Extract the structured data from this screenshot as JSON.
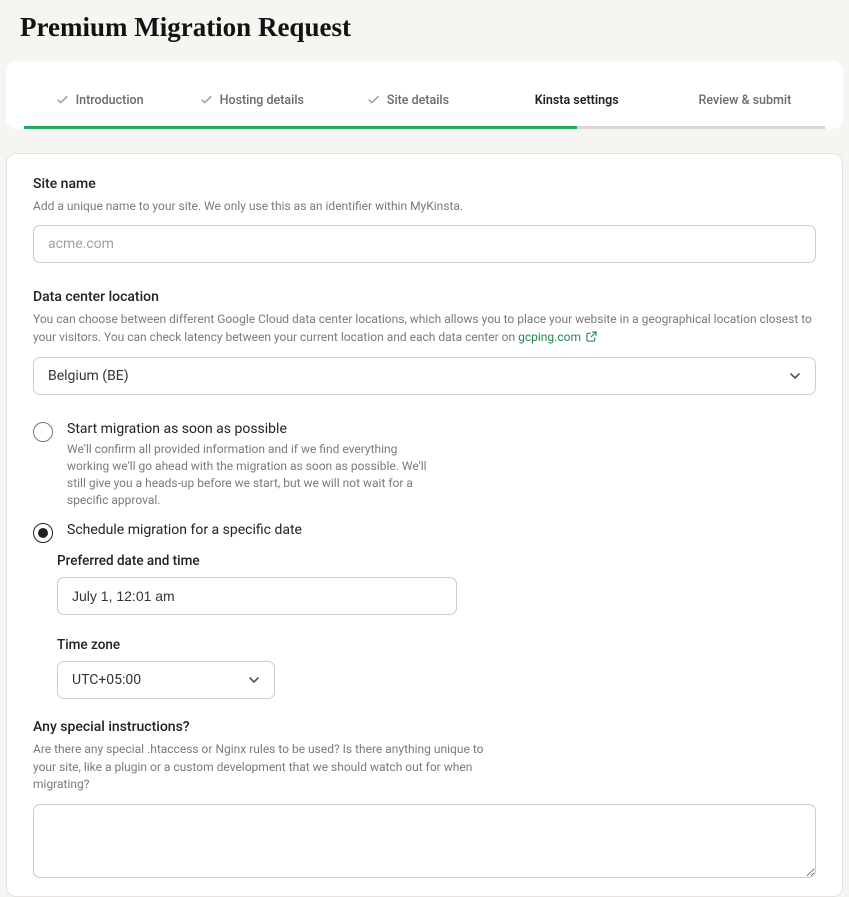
{
  "title": "Premium Migration Request",
  "stepper": {
    "steps": [
      {
        "label": "Introduction",
        "done": true
      },
      {
        "label": "Hosting details",
        "done": true
      },
      {
        "label": "Site details",
        "done": true
      },
      {
        "label": "Kinsta settings",
        "active": true
      },
      {
        "label": "Review & submit",
        "done": false
      }
    ]
  },
  "site_name": {
    "label": "Site name",
    "help": "Add a unique name to your site. We only use this as an identifier within MyKinsta.",
    "placeholder": "acme.com",
    "value": ""
  },
  "data_center": {
    "label": "Data center location",
    "help_prefix": "You can choose between different Google Cloud data center locations, which allows you to place your website in a geographical location closest to your visitors. You can check latency between your current location and each data center on ",
    "help_link_text": "gcping.com",
    "selected": "Belgium (BE)"
  },
  "migration_timing": {
    "asap": {
      "title": "Start migration as soon as possible",
      "sub": "We'll confirm all provided information and if we find everything working we'll go ahead with the migration as soon as possible. We'll still give you a heads-up before we start, but we will not wait for a specific approval."
    },
    "scheduled": {
      "title": "Schedule migration for a specific date"
    },
    "preferred": {
      "label": "Preferred date and time",
      "value": "July 1, 12:01 am"
    },
    "timezone": {
      "label": "Time zone",
      "value": "UTC+05:00"
    }
  },
  "special": {
    "label": "Any special instructions?",
    "help": "Are there any special .htaccess or Nginx rules to be used? Is there anything unique to your site, like a plugin or a custom development that we should watch out for when migrating?",
    "value": ""
  }
}
